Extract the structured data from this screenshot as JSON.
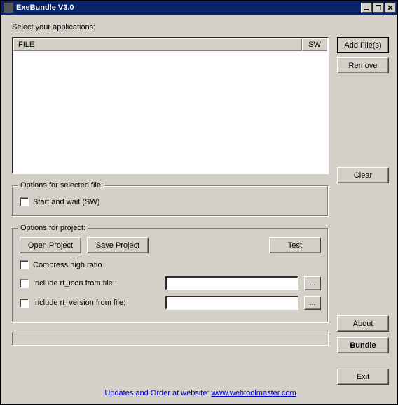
{
  "window": {
    "title": "ExeBundle V3.0"
  },
  "main": {
    "select_label": "Select your applications:",
    "listview": {
      "col_file": "FILE",
      "col_sw": "SW"
    },
    "buttons": {
      "add_files": "Add File(s)",
      "remove": "Remove",
      "clear": "Clear",
      "about": "About",
      "bundle": "Bundle",
      "exit": "Exit"
    }
  },
  "group_selected": {
    "legend": "Options for selected file:",
    "start_and_wait": "Start and wait (SW)"
  },
  "group_project": {
    "legend": "Options for project:",
    "open_project": "Open Project",
    "save_project": "Save Project",
    "test": "Test",
    "compress": "Compress high ratio",
    "include_icon": "Include rt_icon from file:",
    "include_version": "Include rt_version from file:",
    "browse": "...",
    "icon_path": "",
    "version_path": ""
  },
  "footer": {
    "prefix": "Updates and Order at website: ",
    "link": "www.webtoolmaster.com"
  }
}
